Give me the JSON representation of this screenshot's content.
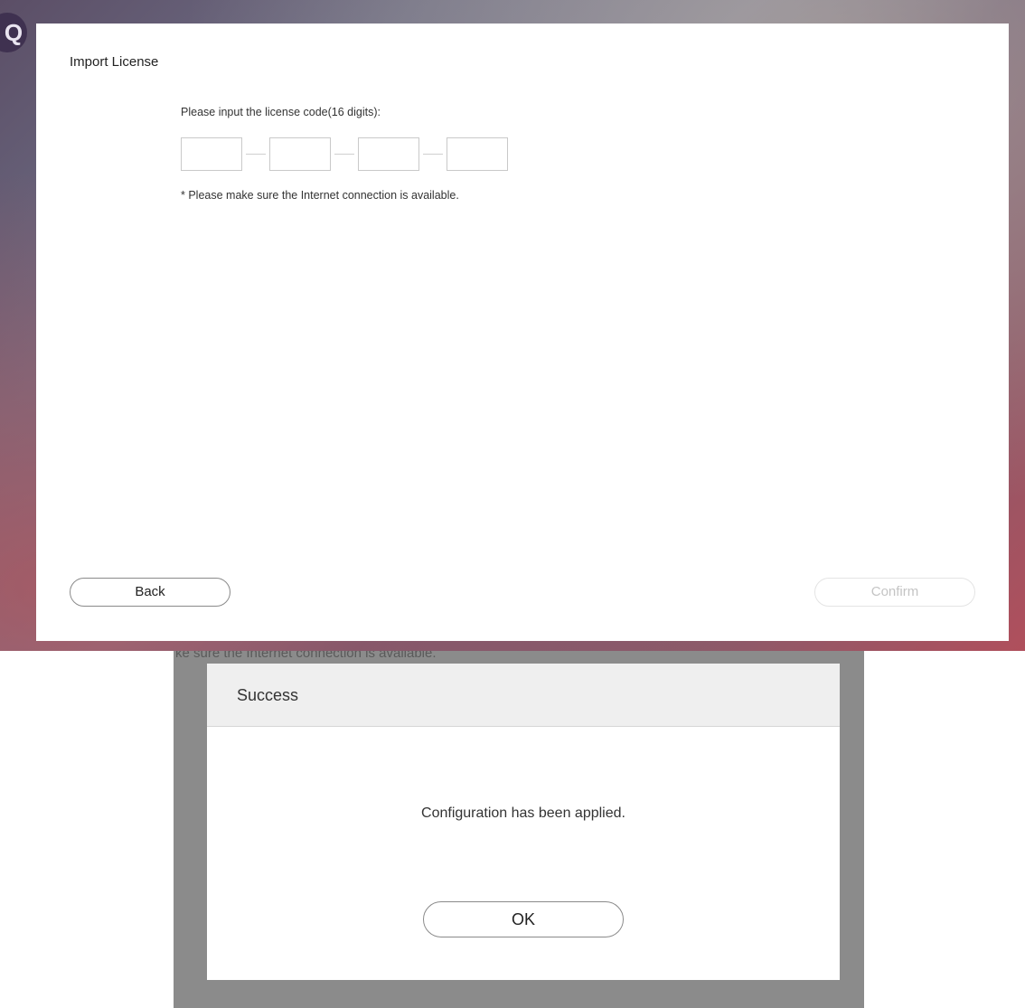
{
  "import_license": {
    "title": "Import License",
    "prompt": "Please input the license code(16 digits):",
    "code_fields": [
      "",
      "",
      "",
      ""
    ],
    "note": "* Please make sure the Internet connection is available.",
    "back_label": "Back",
    "confirm_label": "Confirm",
    "confirm_enabled": false
  },
  "background_text": "ke sure the Internet connection is available.",
  "success_dialog": {
    "title": "Success",
    "message": "Configuration has been applied.",
    "ok_label": "OK"
  },
  "colors": {
    "dimmed_overlay": "#8b8b8b",
    "dialog_header": "#efefef",
    "disabled_text": "#c4c4c4"
  }
}
